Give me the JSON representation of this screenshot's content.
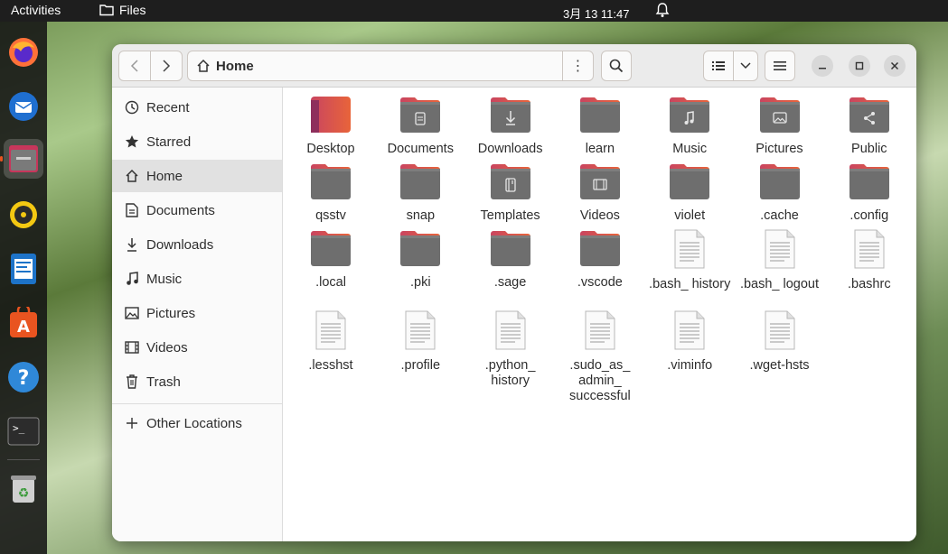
{
  "topbar": {
    "activities": "Activities",
    "app_name": "Files",
    "clock": "3月 13  11:47"
  },
  "dock": {
    "items": [
      "firefox-icon",
      "thunderbird-icon",
      "files-icon",
      "rhythmbox-icon",
      "writer-icon",
      "app-center-icon",
      "help-icon",
      "terminal-icon",
      "trash-icon"
    ]
  },
  "header": {
    "path_label": "Home"
  },
  "sidebar": {
    "items": [
      {
        "label": "Recent",
        "icon": "clock-icon"
      },
      {
        "label": "Starred",
        "icon": "star-icon"
      },
      {
        "label": "Home",
        "icon": "home-icon"
      },
      {
        "label": "Documents",
        "icon": "document-icon"
      },
      {
        "label": "Downloads",
        "icon": "download-icon"
      },
      {
        "label": "Music",
        "icon": "music-icon"
      },
      {
        "label": "Pictures",
        "icon": "picture-icon"
      },
      {
        "label": "Videos",
        "icon": "video-icon"
      },
      {
        "label": "Trash",
        "icon": "trash-icon"
      }
    ],
    "other_locations": "Other Locations"
  },
  "files": [
    {
      "name": "Desktop",
      "kind": "desktop-folder"
    },
    {
      "name": "Documents",
      "kind": "documents-folder"
    },
    {
      "name": "Downloads",
      "kind": "downloads-folder"
    },
    {
      "name": "learn",
      "kind": "folder"
    },
    {
      "name": "Music",
      "kind": "music-folder"
    },
    {
      "name": "Pictures",
      "kind": "pictures-folder"
    },
    {
      "name": "Public",
      "kind": "public-folder"
    },
    {
      "name": "qsstv",
      "kind": "folder"
    },
    {
      "name": "snap",
      "kind": "folder"
    },
    {
      "name": "Templates",
      "kind": "templates-folder"
    },
    {
      "name": "Videos",
      "kind": "videos-folder"
    },
    {
      "name": "violet",
      "kind": "folder"
    },
    {
      "name": ".cache",
      "kind": "folder"
    },
    {
      "name": ".config",
      "kind": "folder"
    },
    {
      "name": ".local",
      "kind": "folder"
    },
    {
      "name": ".pki",
      "kind": "folder"
    },
    {
      "name": ".sage",
      "kind": "folder"
    },
    {
      "name": ".vscode",
      "kind": "folder"
    },
    {
      "name": ".bash_ history",
      "kind": "text-file"
    },
    {
      "name": ".bash_ logout",
      "kind": "text-file"
    },
    {
      "name": ".bashrc",
      "kind": "text-file"
    },
    {
      "name": ".lesshst",
      "kind": "text-file"
    },
    {
      "name": ".profile",
      "kind": "text-file"
    },
    {
      "name": ".python_ history",
      "kind": "text-file"
    },
    {
      "name": ".sudo_as_ admin_ successful",
      "kind": "text-file"
    },
    {
      "name": ".viminfo",
      "kind": "text-file"
    },
    {
      "name": ".wget-hsts",
      "kind": "text-file"
    }
  ],
  "colors": {
    "folder_tab": "#c94560",
    "folder_tab_orange": "#e8643a",
    "folder_body": "#6e6e6e",
    "accent": "#e95420"
  }
}
